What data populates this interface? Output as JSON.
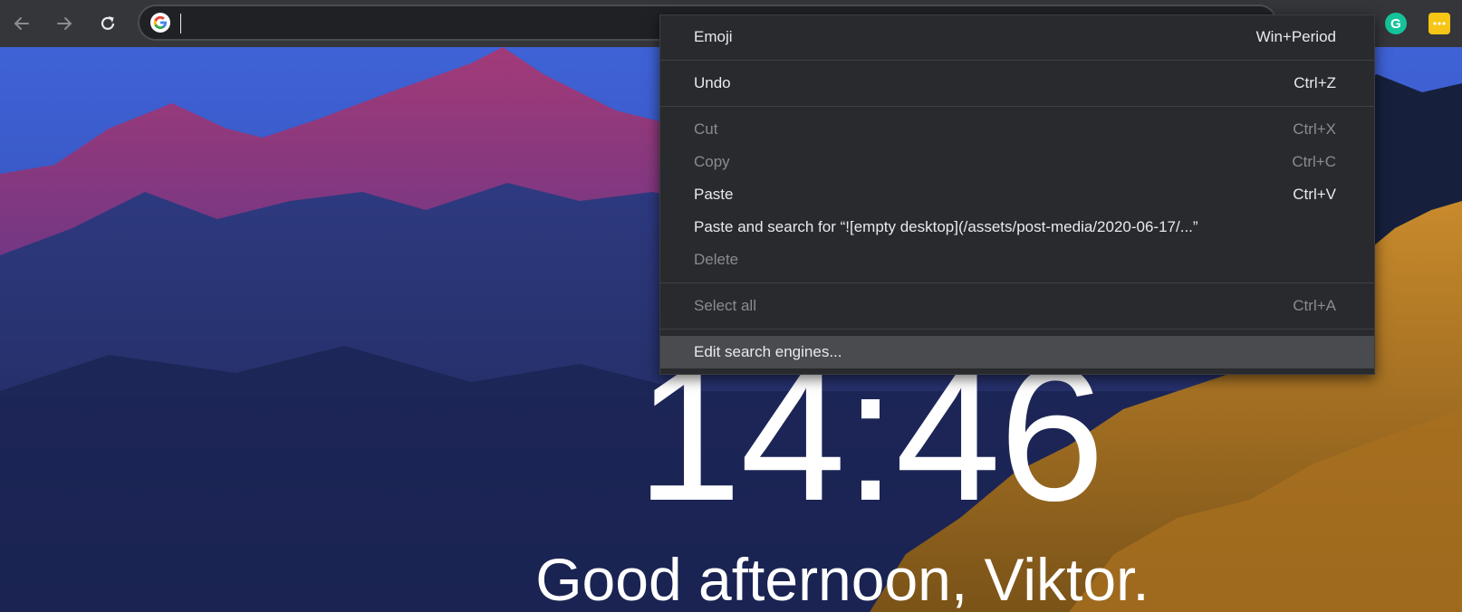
{
  "browser": {
    "address_value": "",
    "address_placeholder": ""
  },
  "newtab": {
    "time": "14:46",
    "greeting": "Good afternoon, Viktor."
  },
  "context_menu": {
    "items": [
      {
        "label": "Emoji",
        "shortcut": "Win+Period",
        "enabled": true
      },
      {
        "label": "Undo",
        "shortcut": "Ctrl+Z",
        "enabled": true
      },
      {
        "label": "Cut",
        "shortcut": "Ctrl+X",
        "enabled": false
      },
      {
        "label": "Copy",
        "shortcut": "Ctrl+C",
        "enabled": false
      },
      {
        "label": "Paste",
        "shortcut": "Ctrl+V",
        "enabled": true
      },
      {
        "label": "Paste and search for “![empty desktop](/assets/post-media/2020-06-17/...”",
        "shortcut": "",
        "enabled": true
      },
      {
        "label": "Delete",
        "shortcut": "",
        "enabled": false
      },
      {
        "label": "Select all",
        "shortcut": "Ctrl+A",
        "enabled": false
      },
      {
        "label": "Edit search engines...",
        "shortcut": "",
        "enabled": true,
        "highlighted": true
      }
    ]
  },
  "extensions": {
    "grammarly_letter": "G"
  },
  "icons": {
    "back": "back-arrow-icon",
    "forward": "forward-arrow-icon",
    "reload": "reload-icon",
    "google": "google-logo-icon",
    "grammarly": "grammarly-icon",
    "more": "more-dots-icon"
  },
  "colors": {
    "toolbar": "#35363a",
    "omnibox": "#202124",
    "menu_bg": "#292a2d",
    "menu_highlight": "#4a4b4e",
    "text": "#e8eaed",
    "disabled_text": "#8a8b8e"
  }
}
